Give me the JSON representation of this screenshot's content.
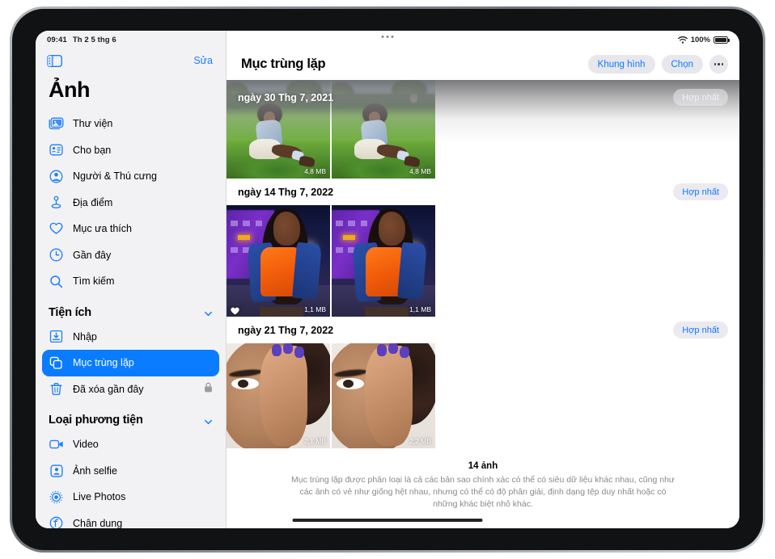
{
  "status_bar": {
    "time": "09:41",
    "date": "Th 2 5 thg 6",
    "battery_percent": "100%",
    "wifi_icon": "wifi-icon",
    "battery_icon": "battery-full-icon",
    "multitask_icon": "multitasking-dots-icon"
  },
  "sidebar": {
    "toggle_icon": "sidebar-toggle-icon",
    "edit_label": "Sửa",
    "app_title": "Ảnh",
    "primary_items": [
      {
        "label": "Thư viện",
        "icon": "photo-library-icon",
        "selected": false
      },
      {
        "label": "Cho bạn",
        "icon": "for-you-icon",
        "selected": false
      },
      {
        "label": "Người & Thú cưng",
        "icon": "people-pets-icon",
        "selected": false
      },
      {
        "label": "Địa điểm",
        "icon": "places-pin-icon",
        "selected": false
      },
      {
        "label": "Mục ưa thích",
        "icon": "heart-icon",
        "selected": false
      },
      {
        "label": "Gần đây",
        "icon": "clock-icon",
        "selected": false
      },
      {
        "label": "Tìm kiếm",
        "icon": "search-icon",
        "selected": false
      }
    ],
    "utilities_section": {
      "title": "Tiện ích",
      "chevron_icon": "chevron-down-icon",
      "items": [
        {
          "label": "Nhập",
          "icon": "import-icon",
          "selected": false,
          "trailing_icon": null
        },
        {
          "label": "Mục trùng lặp",
          "icon": "duplicates-icon",
          "selected": true,
          "trailing_icon": null
        },
        {
          "label": "Đã xóa gần đây",
          "icon": "trash-icon",
          "selected": false,
          "trailing_icon": "lock-icon"
        }
      ]
    },
    "media_types_section": {
      "title": "Loại phương tiện",
      "chevron_icon": "chevron-down-icon",
      "items": [
        {
          "label": "Video",
          "icon": "video-camera-icon",
          "selected": false
        },
        {
          "label": "Ảnh selfie",
          "icon": "selfie-icon",
          "selected": false
        },
        {
          "label": "Live Photos",
          "icon": "live-photos-icon",
          "selected": false
        },
        {
          "label": "Chân dung",
          "icon": "portrait-icon",
          "selected": false
        }
      ]
    },
    "selection_color": "#0a7cff",
    "accent_color": "#1d7dfc"
  },
  "content": {
    "title": "Mục trùng lặp",
    "actions": {
      "frame_label": "Khung hình",
      "select_label": "Chọn",
      "more_icon": "ellipsis-circle-icon"
    },
    "groups": [
      {
        "date": "ngày 30 Thg 7, 2021",
        "merge_label": "Hợp nhất",
        "merge_dimmed": true,
        "scene": "grass",
        "thumbs": [
          {
            "size": "4,8 MB",
            "favorite": false
          },
          {
            "size": "4,8 MB",
            "favorite": false
          }
        ]
      },
      {
        "date": "ngày 14 Thg 7, 2022",
        "merge_label": "Hợp nhất",
        "merge_dimmed": false,
        "scene": "night",
        "thumbs": [
          {
            "size": "1,1 MB",
            "favorite": true
          },
          {
            "size": "1,1 MB",
            "favorite": false
          }
        ]
      },
      {
        "date": "ngày 21 Thg 7, 2022",
        "merge_label": "Hợp nhất",
        "merge_dimmed": false,
        "scene": "face",
        "thumbs": [
          {
            "size": "2,1 MB",
            "favorite": false
          },
          {
            "size": "2,2 MB",
            "favorite": false
          }
        ]
      }
    ],
    "footer": {
      "count": "14 ảnh",
      "description": "Mục trùng lặp được phân loại là cả các bản sao chính xác có thể có siêu dữ liệu khác nhau, cũng như các ảnh có vẻ như giống hệt nhau, nhưng có thể có độ phân giải, định dạng tệp duy nhất hoặc có những khác biệt nhỏ khác."
    }
  },
  "home_indicator": "home-indicator"
}
